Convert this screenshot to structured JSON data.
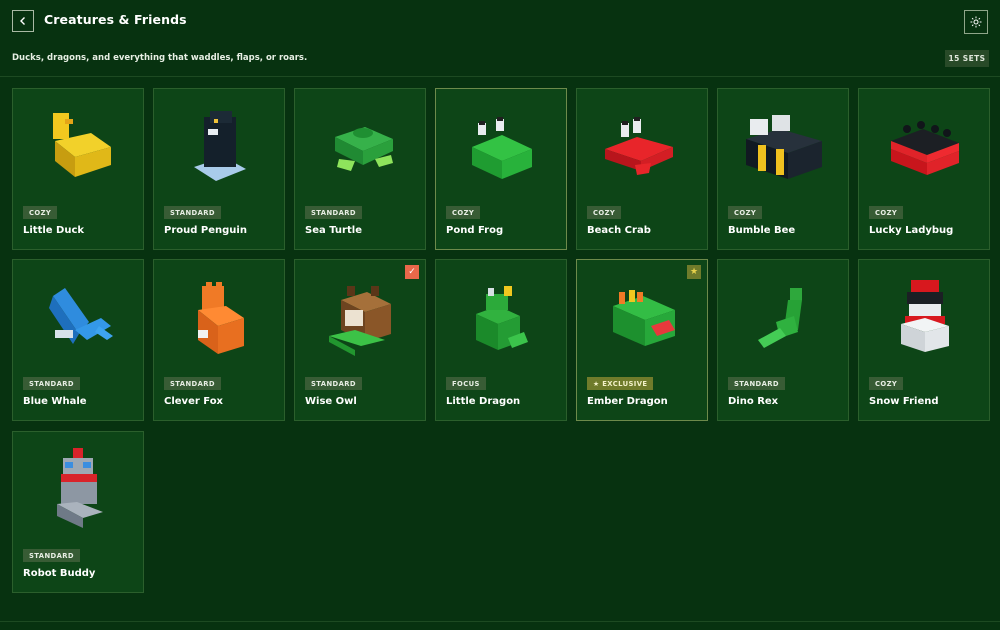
{
  "header": {
    "title": "Creatures & Friends",
    "back_icon": "chevron-left-icon",
    "settings_icon": "sun-icon"
  },
  "subheader": {
    "description": "Ducks, dragons, and everything that waddles, flaps, or roars.",
    "count": "15 SETS"
  },
  "colors": {
    "background": "#073210",
    "card": "#0d4517",
    "tag": "#385c35",
    "exclusive_tag": "#6f7b2b",
    "check_badge": "#e8684a"
  },
  "sets": [
    {
      "name": "Little Duck",
      "tag": "COZY"
    },
    {
      "name": "Proud Penguin",
      "tag": "STANDARD"
    },
    {
      "name": "Sea Turtle",
      "tag": "STANDARD"
    },
    {
      "name": "Pond Frog",
      "tag": "COZY"
    },
    {
      "name": "Beach Crab",
      "tag": "COZY"
    },
    {
      "name": "Bumble Bee",
      "tag": "COZY"
    },
    {
      "name": "Lucky Ladybug",
      "tag": "COZY"
    },
    {
      "name": "Blue Whale",
      "tag": "STANDARD"
    },
    {
      "name": "Clever Fox",
      "tag": "STANDARD"
    },
    {
      "name": "Wise Owl",
      "tag": "STANDARD",
      "badge": "✓"
    },
    {
      "name": "Little Dragon",
      "tag": "FOCUS"
    },
    {
      "name": "Ember Dragon",
      "tag": "★ EXCLUSIVE",
      "badge": "★"
    },
    {
      "name": "Dino Rex",
      "tag": "STANDARD"
    },
    {
      "name": "Snow Friend",
      "tag": "COZY"
    },
    {
      "name": "Robot Buddy",
      "tag": "STANDARD"
    }
  ]
}
